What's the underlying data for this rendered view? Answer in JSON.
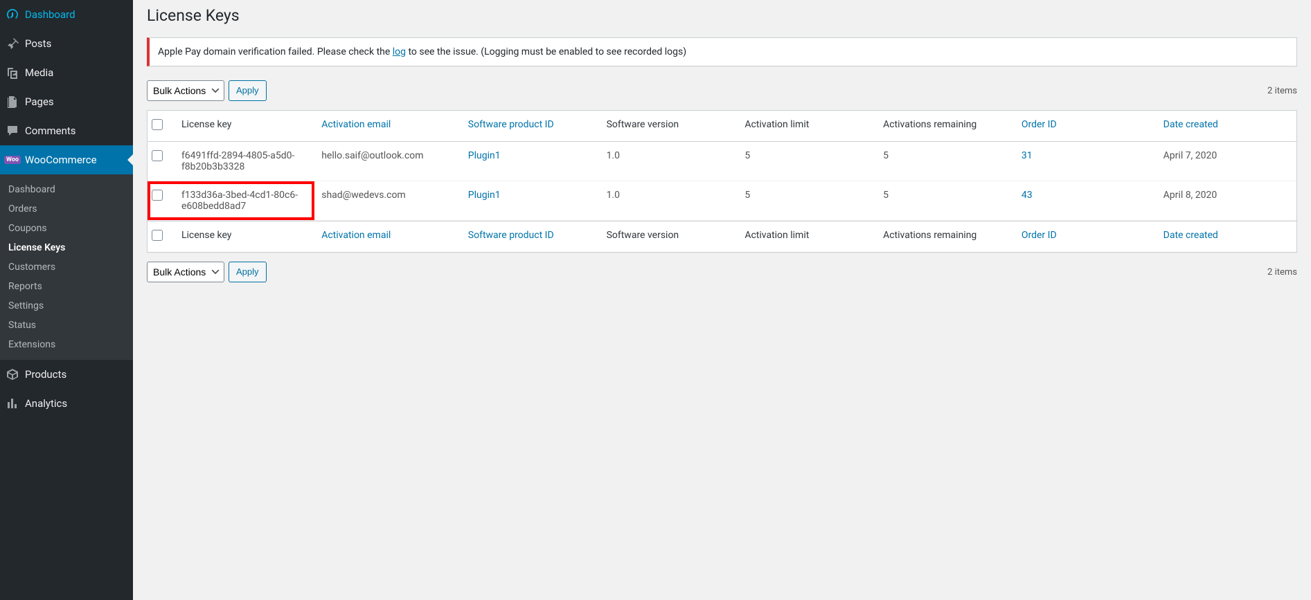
{
  "sidebar": {
    "items": [
      {
        "label": "Dashboard",
        "icon": "dashboard"
      },
      {
        "label": "Posts",
        "icon": "pin"
      },
      {
        "label": "Media",
        "icon": "media"
      },
      {
        "label": "Pages",
        "icon": "pages"
      },
      {
        "label": "Comments",
        "icon": "comments"
      },
      {
        "label": "WooCommerce",
        "icon": "woo",
        "current": true
      },
      {
        "label": "Products",
        "icon": "products"
      },
      {
        "label": "Analytics",
        "icon": "analytics"
      }
    ],
    "woo_submenu": [
      "Dashboard",
      "Orders",
      "Coupons",
      "License Keys",
      "Customers",
      "Reports",
      "Settings",
      "Status",
      "Extensions"
    ],
    "woo_submenu_current": "License Keys"
  },
  "page": {
    "title": "License Keys"
  },
  "notice": {
    "text_before": "Apple Pay domain verification failed. Please check the ",
    "link_text": "log",
    "text_after": " to see the issue. (Logging must be enabled to see recorded logs)"
  },
  "tablenav": {
    "bulk_label": "Bulk Actions",
    "apply_label": "Apply",
    "items_count": "2 items"
  },
  "table": {
    "headers": {
      "license_key": "License key",
      "activation_email": "Activation email",
      "product_id": "Software product ID",
      "version": "Software version",
      "limit": "Activation limit",
      "remaining": "Activations remaining",
      "order_id": "Order ID",
      "date": "Date created"
    },
    "rows": [
      {
        "key": "f6491ffd-2894-4805-a5d0-f8b20b3b3328",
        "email": "hello.saif@outlook.com",
        "product": "Plugin1",
        "version": "1.0",
        "limit": "5",
        "remaining": "5",
        "order": "31",
        "date": "April 7, 2020",
        "highlighted": false
      },
      {
        "key": "f133d36a-3bed-4cd1-80c6-e608bedd8ad7",
        "email": "shad@wedevs.com",
        "product": "Plugin1",
        "version": "1.0",
        "limit": "5",
        "remaining": "5",
        "order": "43",
        "date": "April 8, 2020",
        "highlighted": true
      }
    ]
  }
}
